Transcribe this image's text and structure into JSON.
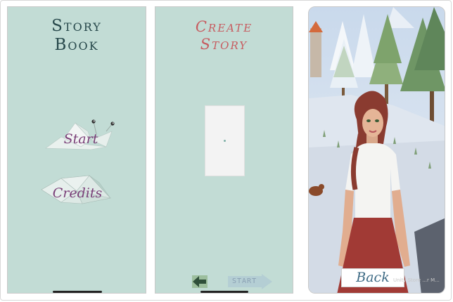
{
  "screen1": {
    "title_line1": "Story",
    "title_line2": "Book",
    "start_label": "Start",
    "credits_label": "Credits"
  },
  "screen2": {
    "title_line1": "Create",
    "title_line2": "Story",
    "start_label": "START"
  },
  "screen3": {
    "back_label": "Back",
    "watermark": "Unity Store ...r M..."
  },
  "colors": {
    "panel_bg": "#c2dcd5",
    "title_dark": "#27484b",
    "title_red": "#c75c60",
    "button_text_purple": "#7a3f78",
    "back_text_blue": "#3d6a84"
  }
}
